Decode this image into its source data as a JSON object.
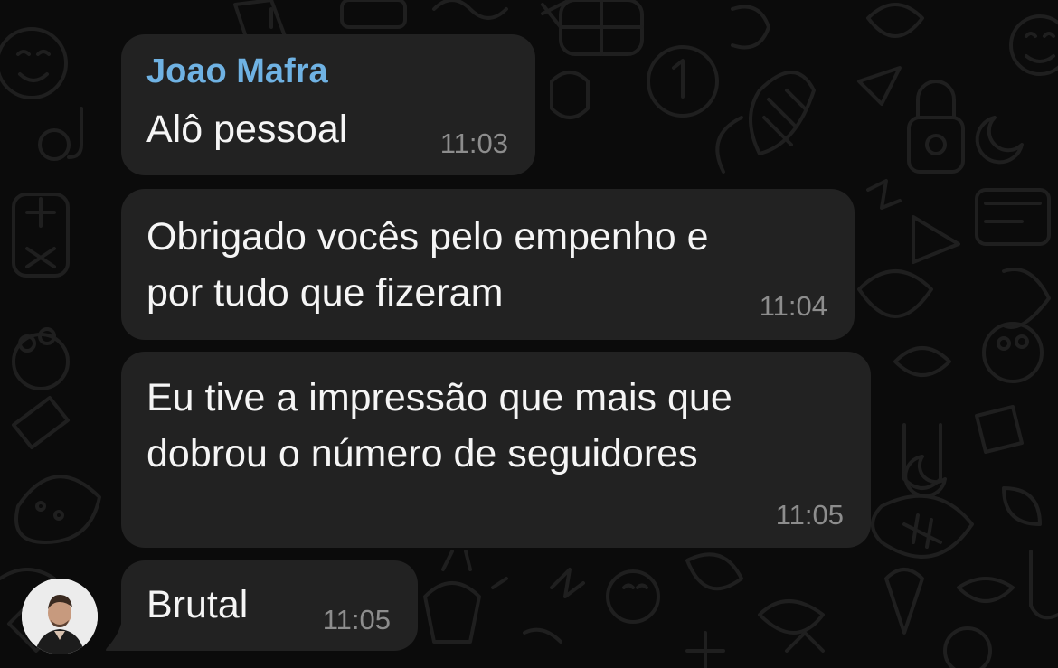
{
  "messages": [
    {
      "sender": "Joao Mafra",
      "lines": [
        "Alô pessoal"
      ],
      "time": "11:03"
    },
    {
      "lines": [
        "Obrigado vocês pelo empenho e",
        "por tudo que fizeram"
      ],
      "time": "11:04"
    },
    {
      "lines": [
        "Eu tive a impressão que mais que",
        "dobrou o número de seguidores"
      ],
      "time": "11:05"
    },
    {
      "lines": [
        "Brutal"
      ],
      "time": "11:05"
    }
  ],
  "colors": {
    "background": "#0b0b0b",
    "bubble": "#222222",
    "sender_name": "#6fb2e3",
    "message_text": "#f5f5f5",
    "timestamp": "#8d8d8d"
  },
  "icons": [
    "chat-wallpaper-doodle-pattern",
    "sender-avatar"
  ]
}
